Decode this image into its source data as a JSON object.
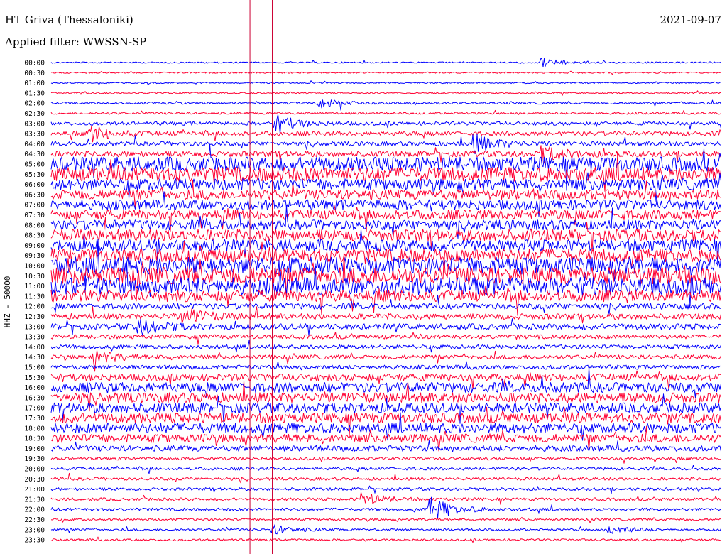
{
  "header": {
    "station": "HT Griva (Thessaloniki)",
    "date": "2021-09-07",
    "filter": "Applied filter: WWSSN-SP"
  },
  "chart_data": {
    "type": "line",
    "title": "HT Griva (Thessaloniki)",
    "ylabel": "HHZ - 50000",
    "xlabel": "",
    "minutes_per_line": 30,
    "trace_colors": [
      "#0000ff",
      "#ff0033"
    ],
    "marker_color": "#cc0033",
    "row_labels": [
      "00:00",
      "00:30",
      "01:00",
      "01:30",
      "02:00",
      "02:30",
      "03:00",
      "03:30",
      "04:00",
      "04:30",
      "05:00",
      "05:30",
      "06:00",
      "06:30",
      "07:00",
      "07:30",
      "08:00",
      "08:30",
      "09:00",
      "09:30",
      "10:00",
      "10:30",
      "11:00",
      "11:30",
      "12:00",
      "12:30",
      "13:00",
      "13:30",
      "14:00",
      "14:30",
      "15:00",
      "15:30",
      "16:00",
      "16:30",
      "17:00",
      "17:30",
      "18:00",
      "18:30",
      "19:00",
      "19:30",
      "20:00",
      "20:30",
      "21:00",
      "21:30",
      "22:00",
      "22:30",
      "23:00",
      "23:30"
    ],
    "noise_level": [
      1,
      1,
      1,
      1,
      1.5,
      1.5,
      2.5,
      3,
      3,
      4,
      10,
      10,
      8,
      7,
      7,
      7,
      7,
      8,
      8,
      9,
      12,
      12,
      12,
      8,
      4,
      4,
      4,
      3,
      3,
      3,
      3,
      5,
      7,
      7,
      7,
      7,
      7,
      6,
      4,
      2,
      2,
      2,
      2,
      2,
      2,
      1.5,
      1.5,
      1.5
    ],
    "events": [
      {
        "row": 0,
        "minute": 22,
        "amplitude": 6
      },
      {
        "row": 4,
        "minute": 12,
        "amplitude": 6
      },
      {
        "row": 6,
        "minute": 10,
        "amplitude": 12
      },
      {
        "row": 7,
        "minute": 1.8,
        "amplitude": 10
      },
      {
        "row": 8,
        "minute": 19,
        "amplitude": 12
      },
      {
        "row": 9,
        "minute": 22,
        "amplitude": 10
      },
      {
        "row": 25,
        "minute": 6,
        "amplitude": 10
      },
      {
        "row": 26,
        "minute": 4,
        "amplitude": 10
      },
      {
        "row": 29,
        "minute": 2,
        "amplitude": 8
      },
      {
        "row": 43,
        "minute": 14,
        "amplitude": 8
      },
      {
        "row": 44,
        "minute": 17,
        "amplitude": 16
      },
      {
        "row": 46,
        "minute": 10,
        "amplitude": 6
      },
      {
        "row": 46,
        "minute": 25,
        "amplitude": 6
      }
    ],
    "time_markers_minute": [
      8.9,
      9.9
    ]
  }
}
